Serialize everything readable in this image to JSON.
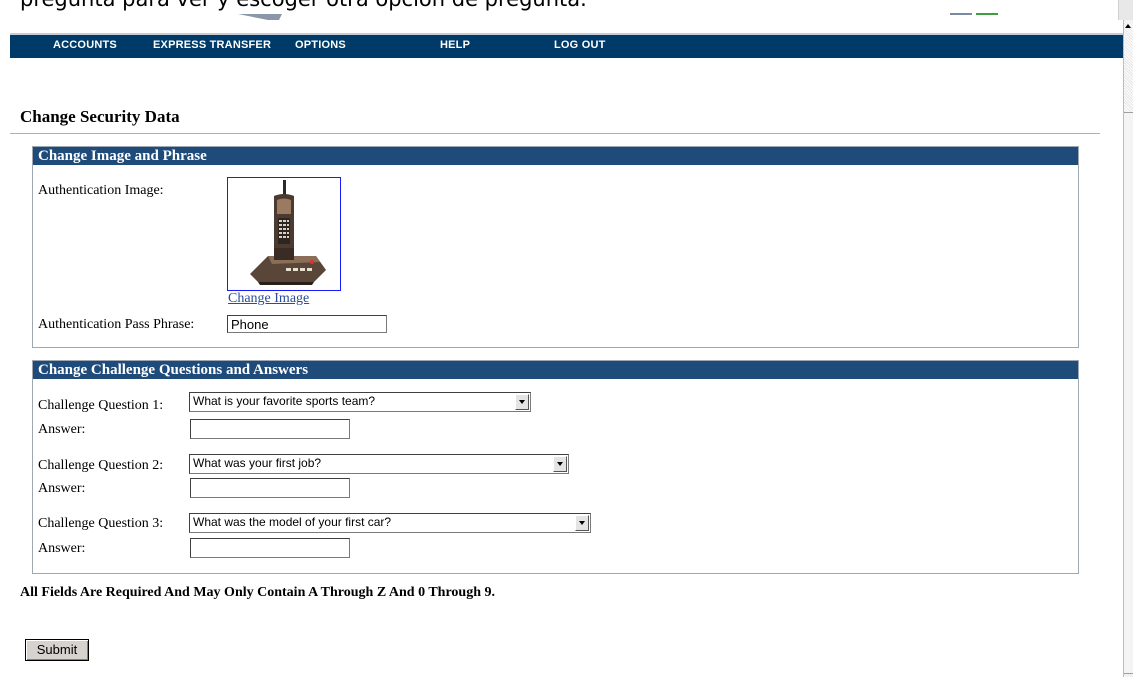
{
  "caption": {
    "text": "pregunta para ver y escoger otra opción de pregunta."
  },
  "nav": {
    "items": [
      {
        "label": "ACCOUNTS"
      },
      {
        "label": "EXPRESS TRANSFER"
      },
      {
        "label": "OPTIONS"
      },
      {
        "label": "HELP"
      },
      {
        "label": "LOG OUT"
      }
    ]
  },
  "page": {
    "title": "Change Security Data"
  },
  "image_section": {
    "header": "Change Image and Phrase",
    "image_label": "Authentication Image:",
    "image_icon": "cordless-phone-image",
    "change_link": "Change Image",
    "phrase_label": "Authentication Pass Phrase:",
    "phrase_value": "Phone"
  },
  "questions_section": {
    "header": "Change Challenge Questions and Answers",
    "questions": [
      {
        "label": "Challenge Question 1:",
        "selected": "What is your favorite sports team?",
        "answer_label": "Answer:",
        "answer_value": ""
      },
      {
        "label": "Challenge Question 2:",
        "selected": "What was your first job?",
        "answer_label": "Answer:",
        "answer_value": ""
      },
      {
        "label": "Challenge Question 3:",
        "selected": "What was the model of your first car?",
        "answer_label": "Answer:",
        "answer_value": ""
      }
    ]
  },
  "note": "All Fields Are Required And May Only Contain A Through Z And 0 Through 9.",
  "submit": {
    "label": "Submit"
  },
  "colors": {
    "nav_bg": "#003a68",
    "panel_header_bg": "#1e4b7a",
    "link": "#2a4c9a"
  }
}
